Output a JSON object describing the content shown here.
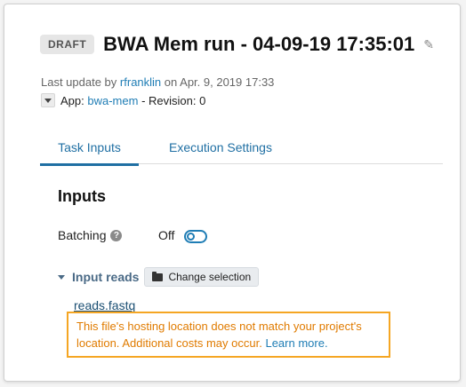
{
  "header": {
    "badge": "DRAFT",
    "title": "BWA Mem run - 04-09-19 17:35:01"
  },
  "meta": {
    "last_update_prefix": "Last update by",
    "user": "rfranklin",
    "date_text": "on Apr. 9, 2019 17:33",
    "app_label": "App:",
    "app_name": "bwa-mem",
    "revision_text": "- Revision: 0"
  },
  "tabs": [
    {
      "label": "Task Inputs",
      "active": true
    },
    {
      "label": "Execution Settings",
      "active": false
    }
  ],
  "inputs": {
    "section_title": "Inputs",
    "batching_label": "Batching",
    "batching_state": "Off",
    "input_reads_label": "Input reads",
    "change_selection_label": "Change selection",
    "file_name": "reads.fastq",
    "warning_text": "This file's hosting location does not match your project's location. Additional costs may occur.",
    "learn_more": "Learn more."
  },
  "colors": {
    "link": "#1f7db5",
    "warning": "#e07b00",
    "warning_border": "#f5a623"
  }
}
